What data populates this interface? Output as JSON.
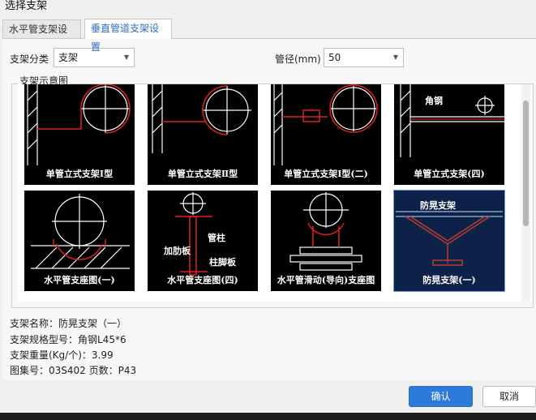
{
  "window": {
    "title": "选择支架"
  },
  "tabs": [
    {
      "label": "水平管支架设置",
      "active": false
    },
    {
      "label": "垂直管道支架设置",
      "active": true
    }
  ],
  "form": {
    "category_label": "支架分类",
    "category_value": "支架",
    "diameter_label": "管径(mm)",
    "diameter_value": "50"
  },
  "gallery": {
    "title": "支架示意图",
    "items": [
      {
        "caption": "单管立式支架Ⅰ型"
      },
      {
        "caption": "单管立式支架Ⅱ型"
      },
      {
        "caption": "单管立式支架Ⅰ型(二)"
      },
      {
        "caption": "单管立式支架(四)",
        "annotation": "角钢"
      },
      {
        "caption": "水平管支座图(一)"
      },
      {
        "caption": "水平管支座图(四)",
        "annotations": [
          "管柱",
          "加肋板",
          "柱脚板"
        ]
      },
      {
        "caption": "水平管滑动(导向)支座图"
      },
      {
        "caption": "防晃支架(一)",
        "annotation": "防晃支架",
        "selected": true
      }
    ]
  },
  "details": {
    "name_line": "支架名称：防晃支架（一）",
    "spec_line": "支架规格型号：角钢L45*6",
    "weight_line": "支架重量(Kg/个)：3.99",
    "atlas_line": "图集号：03S402   页数：P43"
  },
  "buttons": {
    "confirm": "确认",
    "cancel": "取消"
  },
  "colors": {
    "accent": "#2e7ad8",
    "drawing_bg": "#000000",
    "selected_bg": "#0d2248",
    "drawing_red": "#e02020"
  }
}
